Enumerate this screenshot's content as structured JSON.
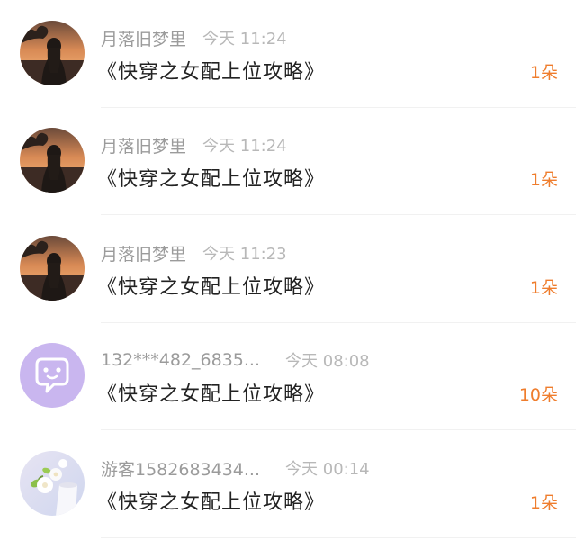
{
  "records": [
    {
      "username": "月落旧梦里",
      "time": "今天 11:24",
      "book_title": "《快穿之女配上位攻略》",
      "count": "1朵",
      "avatar_icon": "sunset-girl-avatar"
    },
    {
      "username": "月落旧梦里",
      "time": "今天 11:24",
      "book_title": "《快穿之女配上位攻略》",
      "count": "1朵",
      "avatar_icon": "sunset-girl-avatar"
    },
    {
      "username": "月落旧梦里",
      "time": "今天 11:23",
      "book_title": "《快穿之女配上位攻略》",
      "count": "1朵",
      "avatar_icon": "sunset-girl-avatar"
    },
    {
      "username": "132***482_6835...",
      "time": "今天 08:08",
      "book_title": "《快穿之女配上位攻略》",
      "count": "10朵",
      "avatar_icon": "chat-bubble-avatar"
    },
    {
      "username": "游客1582683434...",
      "time": "今天 00:14",
      "book_title": "《快穿之女配上位攻略》",
      "count": "1朵",
      "avatar_icon": "flower-avatar"
    }
  ],
  "colors": {
    "accent": "#ef7d2d",
    "username": "#9b9b9b",
    "time": "#b8b8b8",
    "title": "#222222",
    "chat_avatar_bg": "#c9b6ef"
  }
}
